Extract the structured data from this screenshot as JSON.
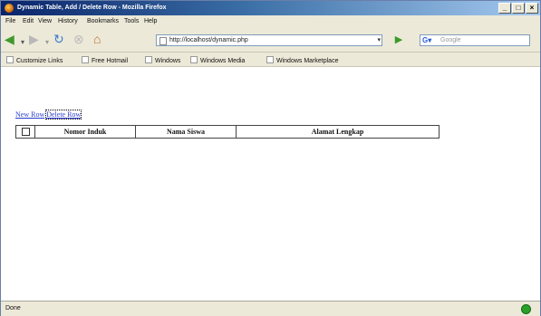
{
  "window": {
    "title": "Dynamic Table, Add / Delete Row - Mozilla Firefox"
  },
  "menu": [
    "File",
    "Edit",
    "View",
    "History",
    "Bookmarks",
    "Tools",
    "Help"
  ],
  "address": {
    "url": "http://localhost/dynamic.php"
  },
  "search": {
    "placeholder": "Google"
  },
  "bookmarks": [
    "Customize Links",
    "Free Hotmail",
    "Windows",
    "Windows Media",
    "Windows Marketplace"
  ],
  "page": {
    "new_row_link": "New Row",
    "delete_row_link": "Delete Row",
    "table_headers": [
      "Nomor Induk",
      "Nama Siswa",
      "Alamat Lengkap"
    ]
  },
  "status": {
    "text": "Done"
  }
}
